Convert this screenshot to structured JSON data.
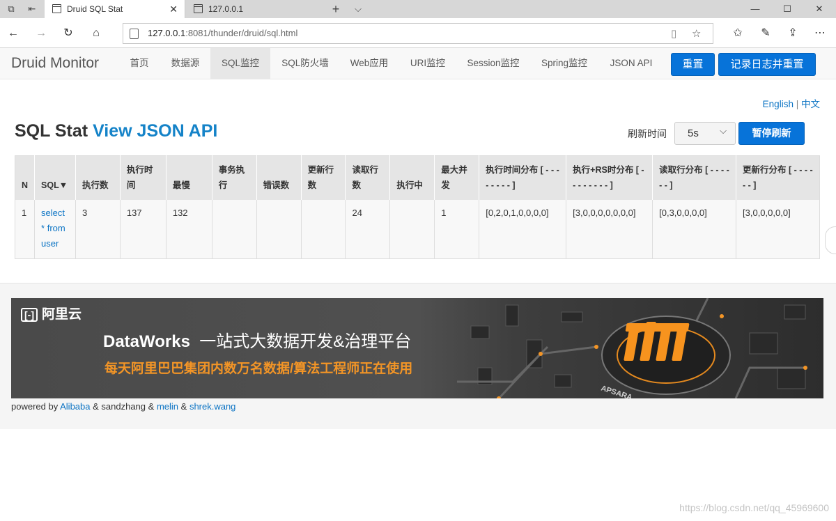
{
  "browser": {
    "tabs": [
      {
        "title": "Druid SQL Stat",
        "active": true
      },
      {
        "title": "127.0.0.1",
        "active": false
      }
    ],
    "new_tab_icon": "+",
    "url_host": "127.0.0.1",
    "url_rest": ":8081/thunder/druid/sql.html"
  },
  "navbar": {
    "brand": "Druid Monitor",
    "items": [
      "首页",
      "数据源",
      "SQL监控",
      "SQL防火墙",
      "Web应用",
      "URI监控",
      "Session监控",
      "Spring监控",
      "JSON API"
    ],
    "active_item": "SQL监控",
    "reset_label": "重置",
    "log_reset_label": "记录日志并重置"
  },
  "lang": {
    "english": "English",
    "separator": "|",
    "chinese": "中文"
  },
  "page": {
    "title_plain": "SQL Stat",
    "title_link": "View JSON API",
    "refresh_label": "刷新时间",
    "refresh_value": "5s",
    "pause_label": "暂停刷新"
  },
  "table": {
    "headers": [
      "N",
      "SQL▼",
      "执行数",
      "执行时间",
      "最慢",
      "事务执行",
      "错误数",
      "更新行数",
      "读取行数",
      "执行中",
      "最大并发",
      "执行时间分布 [ - - - - - - - - ]",
      "执行+RS时分布 [ - - - - - - - - ]",
      "读取行分布 [ - - - - - - ]",
      "更新行分布 [ - - - - - - ]"
    ],
    "rows": [
      [
        "1",
        "select * from user",
        "3",
        "137",
        "132",
        "",
        "",
        "",
        "24",
        "",
        "1",
        "[0,2,0,1,0,0,0,0]",
        "[3,0,0,0,0,0,0,0]",
        "[0,3,0,0,0,0]",
        "[3,0,0,0,0,0]"
      ]
    ]
  },
  "banner": {
    "brand": "阿里云",
    "product": "DataWorks",
    "headline": "一站式大数据开发&治理平台",
    "slogan": "每天阿里巴巴集团内数万名数据/算法工程师正在使用",
    "chip_text": "APSARA"
  },
  "footer": {
    "powered_by": "powered by",
    "link1": "Alibaba",
    "amp1": "& sandzhang &",
    "link2": "melin",
    "amp2": "&",
    "link3": "shrek.wang"
  },
  "watermark": "https://blog.csdn.net/qq_45969600",
  "colors": {
    "accent": "#0773d9",
    "link": "#0c74c4",
    "banner_orange": "#f39526"
  }
}
